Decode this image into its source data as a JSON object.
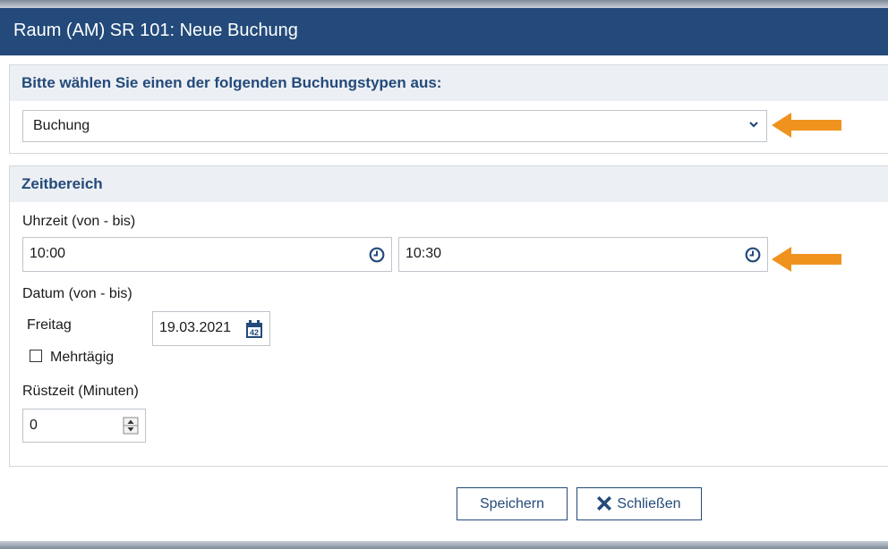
{
  "dialog": {
    "title": "Raum (AM) SR 101: Neue Buchung"
  },
  "booking_type": {
    "heading": "Bitte wählen Sie einen der folgenden Buchungstypen aus:",
    "selected": "Buchung"
  },
  "time_range": {
    "heading": "Zeitbereich",
    "time_label": "Uhrzeit (von - bis)",
    "time_from": "10:00",
    "time_to": "10:30",
    "date_label": "Datum (von - bis)",
    "weekday": "Freitag",
    "date": "19.03.2021",
    "calendar_day": "42",
    "multiday_label": "Mehrtägig",
    "multiday_checked": false,
    "setup_label": "Rüstzeit (Minuten)",
    "setup_value": "0"
  },
  "buttons": {
    "save": "Speichern",
    "close": "Schließen"
  },
  "colors": {
    "accent": "#234a7a",
    "highlight_arrow": "#f0931e"
  }
}
